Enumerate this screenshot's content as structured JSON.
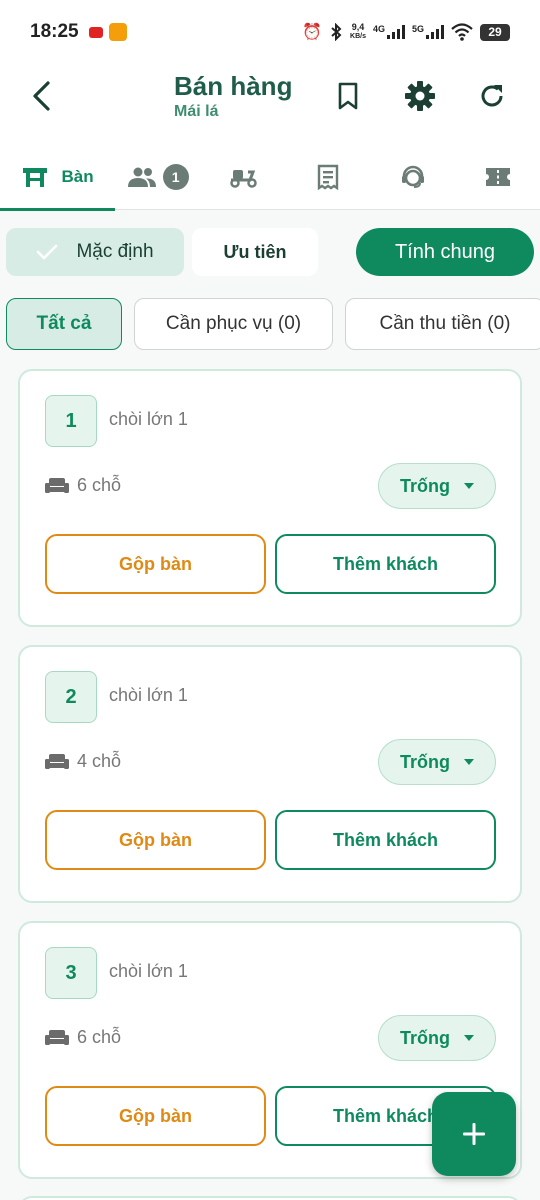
{
  "status_bar": {
    "time": "18:25",
    "network_speed_value": "9,4",
    "network_speed_unit": "KB/s",
    "sim1_type": "4G",
    "sim2_type": "5G",
    "battery": "29"
  },
  "app_bar": {
    "title": "Bán hàng",
    "subtitle": "Mái lá"
  },
  "tabs": [
    {
      "label": "Bàn",
      "icon": "table-icon",
      "active": true
    },
    {
      "label": "",
      "icon": "people-icon",
      "badge": "1"
    },
    {
      "label": "",
      "icon": "scooter-icon"
    },
    {
      "label": "",
      "icon": "receipt-icon"
    },
    {
      "label": "",
      "icon": "support-icon"
    },
    {
      "label": "",
      "icon": "ticket-icon"
    }
  ],
  "mode": {
    "default_label": "Mặc định",
    "priority_label": "Ưu tiên",
    "total_label": "Tính chung"
  },
  "filters": [
    {
      "label": "Tất cả",
      "active": true
    },
    {
      "label": "Cần phục vụ (0)"
    },
    {
      "label": "Cần thu tiền (0)"
    }
  ],
  "tables": [
    {
      "number": "1",
      "area": "chòi lớn 1",
      "seats": "6 chỗ",
      "status": "Trống",
      "merge_label": "Gộp bàn",
      "add_label": "Thêm khách"
    },
    {
      "number": "2",
      "area": "chòi lớn 1",
      "seats": "4 chỗ",
      "status": "Trống",
      "merge_label": "Gộp bàn",
      "add_label": "Thêm khách"
    },
    {
      "number": "3",
      "area": "chòi lớn 1",
      "seats": "6 chỗ",
      "status": "Trống",
      "merge_label": "Gộp bàn",
      "add_label": "Thêm khách"
    }
  ],
  "colors": {
    "primary": "#0f8a5f",
    "primary_light": "#d7ece4",
    "accent_orange": "#e08a16",
    "title": "#1f5c4a"
  }
}
